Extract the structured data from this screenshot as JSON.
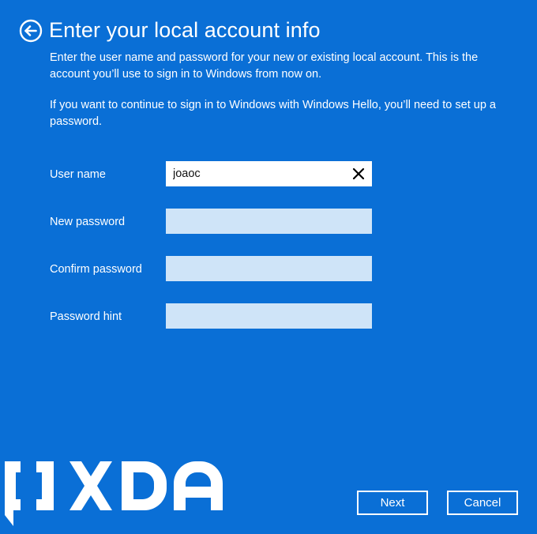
{
  "page": {
    "title": "Enter your local account info",
    "description_1": "Enter the user name and password for your new or existing local account. This is the account you’ll use to sign in to Windows from now on.",
    "description_2": "If you want to continue to sign in to Windows with Windows Hello, you’ll need to set up a password."
  },
  "form": {
    "username": {
      "label": "User name",
      "value": "joaoc"
    },
    "new_password": {
      "label": "New password",
      "value": ""
    },
    "confirm_password": {
      "label": "Confirm password",
      "value": ""
    },
    "password_hint": {
      "label": "Password hint",
      "value": ""
    }
  },
  "buttons": {
    "next": "Next",
    "cancel": "Cancel"
  },
  "watermark": {
    "text": "XDA"
  },
  "icons": {
    "back": "back-arrow-circle-icon",
    "clear": "close-x-icon",
    "logo": "xda-logo-icon"
  },
  "colors": {
    "background": "#0a6fd6",
    "text": "#ffffff",
    "input_filled": "#ffffff",
    "input_empty": "#cfe4f8"
  }
}
